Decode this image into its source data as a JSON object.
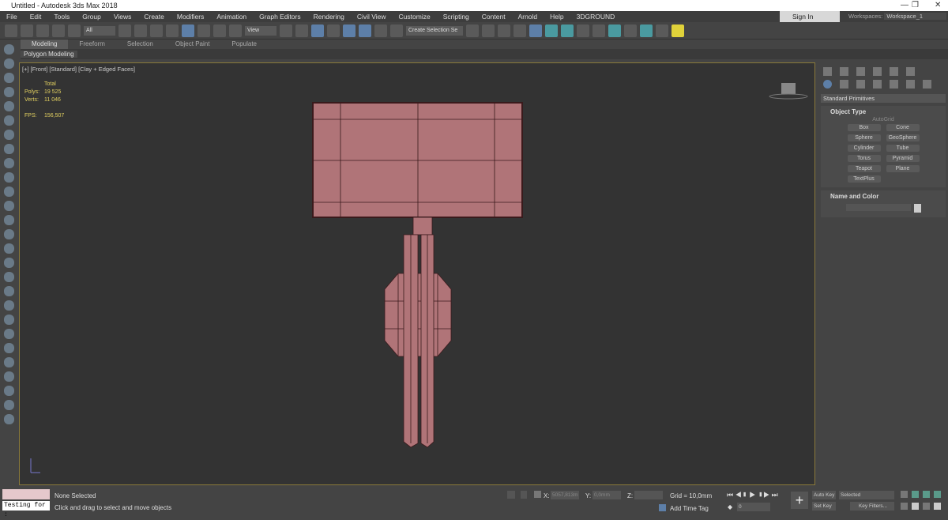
{
  "title": "Untitled - Autodesk 3ds Max 2018",
  "menu": [
    "File",
    "Edit",
    "Tools",
    "Group",
    "Views",
    "Create",
    "Modifiers",
    "Animation",
    "Graph Editors",
    "Rendering",
    "Civil View",
    "Customize",
    "Scripting",
    "Content",
    "Arnold",
    "Help",
    "3DGROUND"
  ],
  "signin": "Sign In",
  "workspaces": {
    "label": "Workspaces:",
    "value": "Workspace_1"
  },
  "toolbar": {
    "filter": "All",
    "refcoord": "View",
    "selection_set": "Create Selection Se"
  },
  "ribbon": {
    "tabs": [
      "Modeling",
      "Freeform",
      "Selection",
      "Object Paint",
      "Populate"
    ],
    "active": "Modeling",
    "sub": "Polygon Modeling"
  },
  "viewport": {
    "label": "[+] [Front] [Standard] [Clay + Edged Faces]",
    "stats": {
      "total": "Total",
      "polys_label": "Polys:",
      "polys": "19 525",
      "verts_label": "Verts:",
      "verts": "11 046",
      "fps_label": "FPS:",
      "fps": "156,507"
    },
    "model_color": "#b07478"
  },
  "command_panel": {
    "dropdown": "Standard Primitives",
    "object_type": "Object Type",
    "autogrid": "AutoGrid",
    "buttons": [
      "Box",
      "Cone",
      "Sphere",
      "GeoSphere",
      "Cylinder",
      "Tube",
      "Torus",
      "Pyramid",
      "Teapot",
      "Plane",
      "TextPlus"
    ],
    "name_color": "Name and Color"
  },
  "status": {
    "maxscript": "Testing for :",
    "selected": "None Selected",
    "prompt": "Click and drag to select and move objects",
    "x_label": "X:",
    "x": "5057,813m",
    "y_label": "Y:",
    "y": "0,0mm",
    "z_label": "Z:",
    "grid": "Grid = 10,0mm",
    "add_time_tag": "Add Time Tag",
    "frame": "0",
    "auto_key": "Auto Key",
    "set_key": "Set Key",
    "key_mode": "Selected",
    "key_filters": "Key Filters..."
  }
}
